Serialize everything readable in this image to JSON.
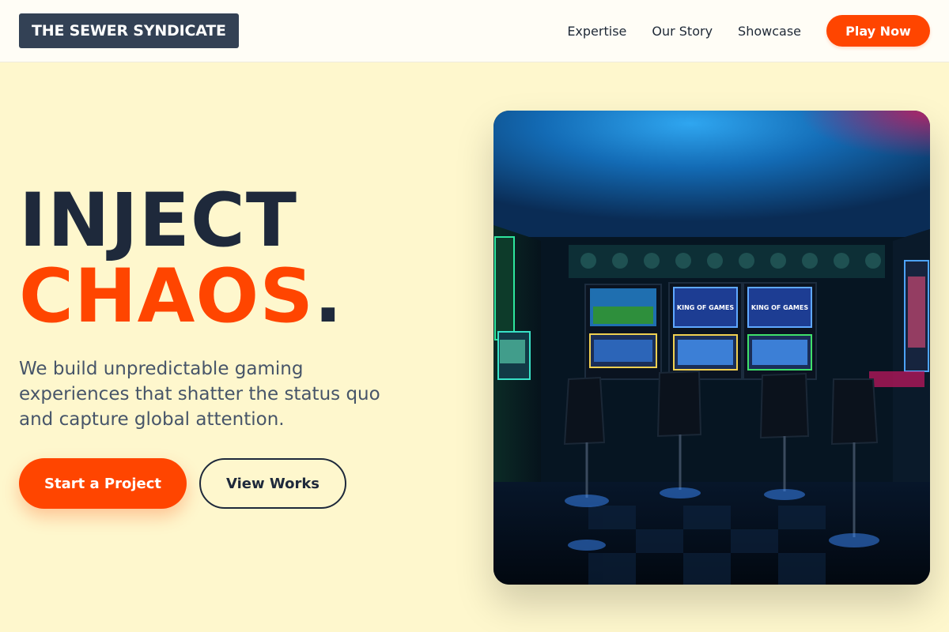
{
  "header": {
    "logo": "THE SEWER SYNDICATE",
    "nav": [
      {
        "label": "Expertise"
      },
      {
        "label": "Our Story"
      },
      {
        "label": "Showcase"
      }
    ],
    "play_label": "Play Now"
  },
  "hero": {
    "headline_line1": "INJECT",
    "headline_line2": "CHAOS",
    "headline_dot": ".",
    "subtext": "We build unpredictable gaming experiences that shatter the status quo and capture global attention.",
    "primary_cta": "Start a Project",
    "secondary_cta": "View Works",
    "image": {
      "screen_text_1": "KING OF GAMES",
      "screen_text_2": "KING OF GAMES"
    }
  },
  "colors": {
    "accent": "#FF4500",
    "dark": "#1E293B",
    "background": "#FEF7CD",
    "logo_bg": "#334155"
  }
}
